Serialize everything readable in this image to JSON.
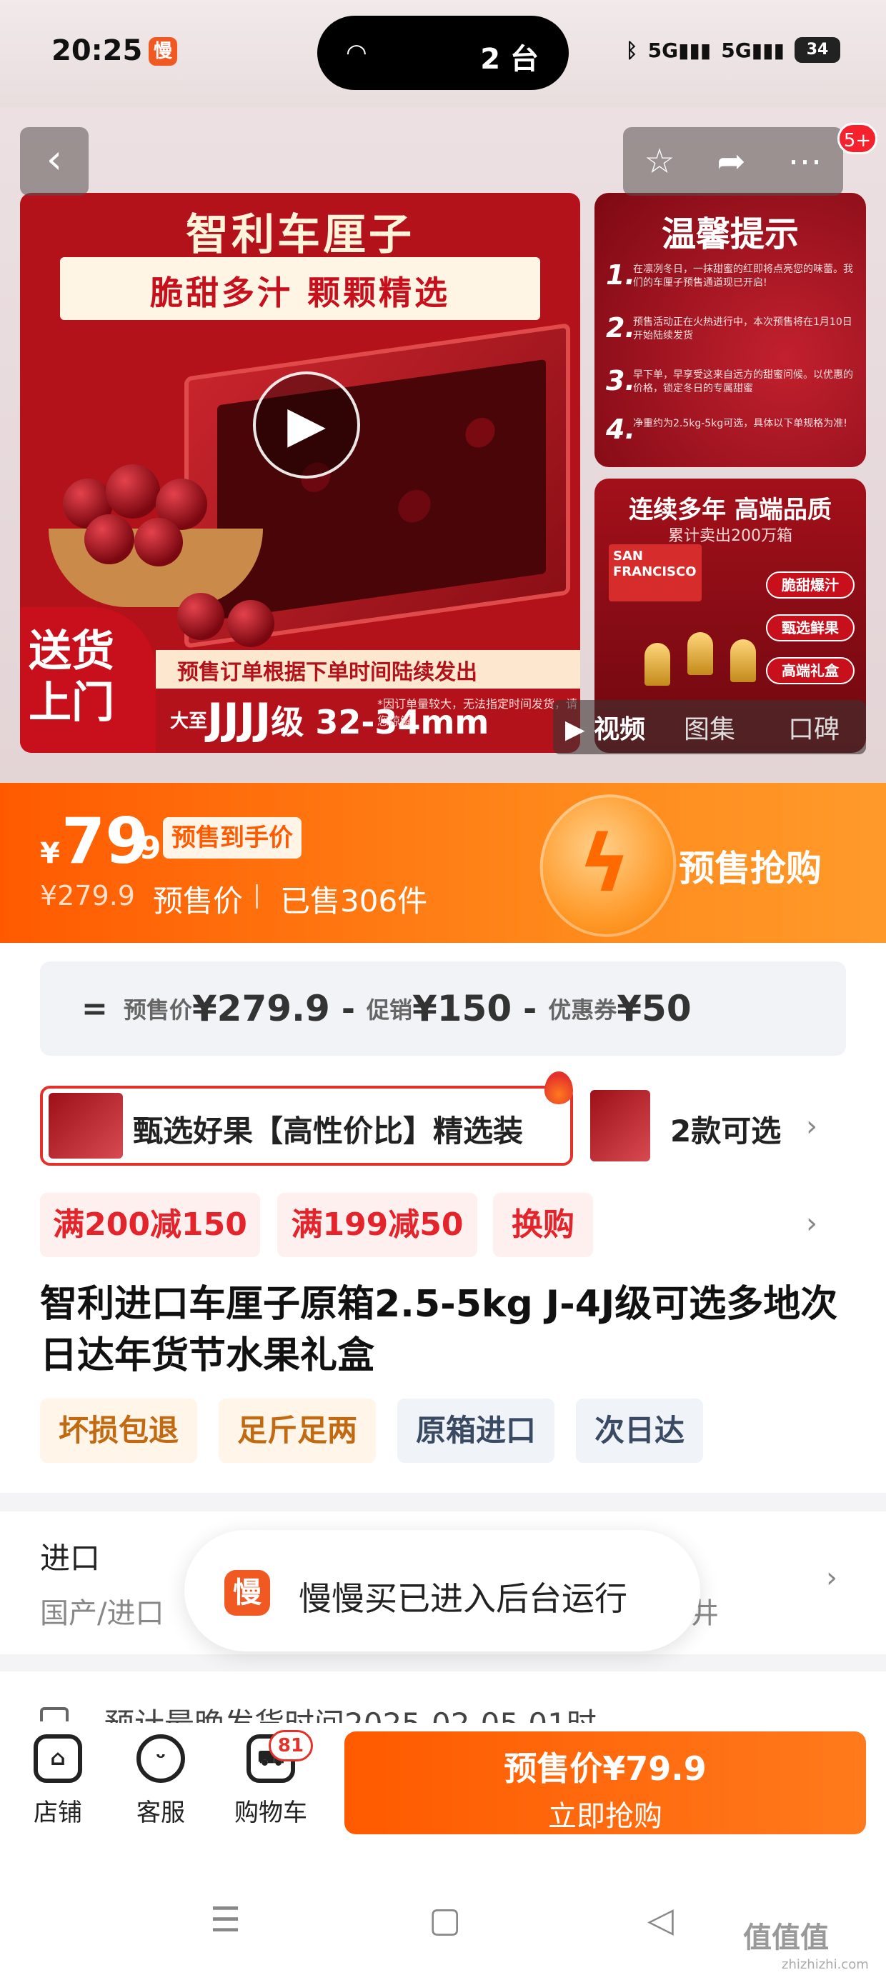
{
  "status_bar": {
    "time": "20:25",
    "app_icon_text": "慢",
    "island_text": "2 台",
    "network1": "5G",
    "network2": "5G",
    "battery": "34"
  },
  "gallery": {
    "main_title": "智利车厘子",
    "main_subtitle": "脆甜多汁  颗颗精选",
    "delivery_line1": "送货",
    "delivery_line2": "上门",
    "notice": "预售订单根据下单时间陆续发出",
    "grade_prefix": "大至",
    "grade": "JJJJ",
    "grade_suffix": "级 32-34mm",
    "grade_note": "*因订单量较大，无法指定时间发货，请您谅解",
    "tip_title": "温馨提示",
    "tips": [
      {
        "num": "1.",
        "text": "在凛冽冬日，一抹甜蜜的红即将点亮您的味蕾。我们的车厘子预售通道现已开启!"
      },
      {
        "num": "2.",
        "text": "预售活动正在火热进行中，本次预售将在1月10日开始陆续发货"
      },
      {
        "num": "3.",
        "text": "早下单，早享受这来自远方的甜蜜问候。以优惠的价格，锁定冬日的专属甜蜜"
      },
      {
        "num": "4.",
        "text": "净重约为2.5kg-5kg可选，具体以下单规格为准!"
      }
    ],
    "award_title": "连续多年 高端品质",
    "award_sub": "累计卖出200万箱",
    "award_logo": "SAN FRANCISCO",
    "award_tags": [
      "脆甜爆汁",
      "甄选鲜果",
      "高端礼盒"
    ],
    "badge_count": "5+",
    "media_tabs": [
      "▶ 视频",
      "图集",
      "口碑"
    ]
  },
  "price": {
    "currency": "¥",
    "main": "79",
    "decimal": ".9",
    "tag": "预售到手价",
    "original": "¥279.9",
    "label": "预售价",
    "sold": "已售306件",
    "cta": "预售抢购"
  },
  "breakdown": {
    "eq": "=",
    "presale_label": "预售价",
    "presale_value": "¥279.9",
    "promo_label": "促销",
    "promo_value": "¥150",
    "coupon_label": "优惠券",
    "coupon_value": "¥50",
    "minus": "-"
  },
  "variant": {
    "selected": "甄选好果【高性价比】精选装",
    "count": "2款可选"
  },
  "promos": [
    "满200减150",
    "满199减50",
    "换购"
  ],
  "product": {
    "title": "智利进口车厘子原箱2.5-5kg J-4J级可选多地次日达年货节水果礼盒",
    "tags": [
      "坏损包退",
      "足斤足两",
      "原箱进口",
      "次日达"
    ]
  },
  "spec": {
    "label": "进口",
    "value": "国产/进口",
    "trail": "井"
  },
  "shipping": {
    "text": "预计最晚发货时间2025-02-05 01时"
  },
  "toast": {
    "icon": "慢",
    "text": "慢慢买已进入后台运行"
  },
  "actions": {
    "store": "店铺",
    "service": "客服",
    "cart": "购物车",
    "cart_count": "81",
    "buy_price": "预售价¥79.9",
    "buy_label": "立即抢购"
  },
  "watermark": {
    "main": "值值值",
    "sub": "zhizhizhi.com"
  },
  "colors": {
    "accent": "#ff5a00",
    "promo_red": "#e4232b",
    "product_red": "#b3121a"
  }
}
